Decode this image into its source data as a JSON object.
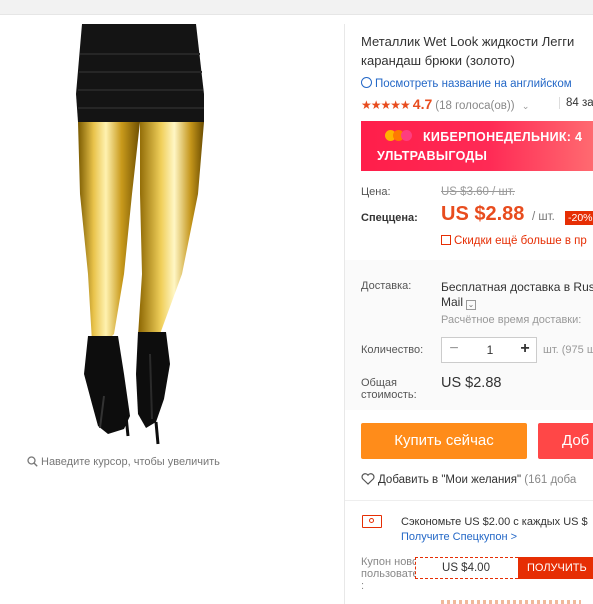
{
  "breadcrumb": "",
  "image": {
    "zoom_hint": "Наведите курсор, чтобы увеличить"
  },
  "product": {
    "title_line1": "Металлик Wet Look жидкости Легги",
    "title_line2": "карандаш брюки (золото)",
    "translate_link": "Посмотреть название на английском",
    "rating": {
      "stars": "★★★★★",
      "score": "4.7",
      "votes": "(18 голоса(ов))",
      "orders": "84 за"
    }
  },
  "promo": {
    "line1": "КИБЕРПОНЕДЕЛЬНИК: 4",
    "line2": "УЛЬТРАВЫГОДЫ",
    "dot_colors": [
      "#ffb300",
      "#ff7a00",
      "#ff3d7f"
    ]
  },
  "price": {
    "label": "Цена:",
    "old": "US $3.60 / шт.",
    "special_label": "Спеццена:",
    "current": "US $2.88",
    "per_unit": "/ шт.",
    "discount": "-20%",
    "coupon_text": "Скидки ещё больше в пр"
  },
  "shipping": {
    "label": "Доставка:",
    "method_line1": "Бесплатная доставка в Rus",
    "method_line2": "Mail",
    "eta": "Расчётное время доставки:"
  },
  "quantity": {
    "label": "Количество:",
    "minus": "−",
    "value": "1",
    "plus": "+",
    "stock": "шт. (975 ш"
  },
  "total": {
    "label_line1": "Общая",
    "label_line2": "стоимость:",
    "value": "US $2.88"
  },
  "actions": {
    "buy_now": "Купить сейчас",
    "add_to_cart": "Доб",
    "wishlist": "Добавить в \"Мои желания\"",
    "wishlist_count": "(161 доба"
  },
  "coupons": {
    "save_text": "Сэкономьте US $2.00 с каждых US $",
    "get_coupon": "Получите Спецкупон >",
    "new_user_line1": "Купон нового",
    "new_user_line2": "пользователя",
    "new_user_line3": ":",
    "amount": "US $4.00",
    "get_button": "ПОЛУЧИТЬ"
  },
  "colors": {
    "accent_red": "#e84c1e",
    "buy_orange": "#ff8c1a",
    "cart_red": "#ff4747",
    "link_blue": "#2468c7",
    "gold": "#d4a017"
  }
}
